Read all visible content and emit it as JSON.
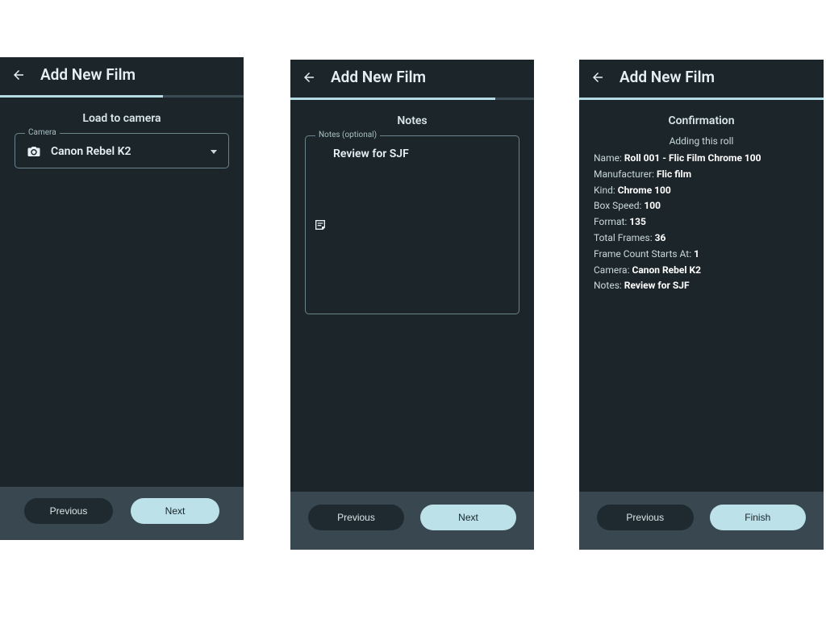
{
  "header": {
    "title": "Add New Film"
  },
  "progress": {
    "screen1_pct": 67,
    "screen2_pct": 84,
    "screen3_pct": 100
  },
  "screen1": {
    "section": "Load to camera",
    "camera_field_label": "Camera",
    "camera_value": "Canon Rebel K2"
  },
  "screen2": {
    "section": "Notes",
    "notes_field_label": "Notes (optional)",
    "notes_value": "Review for SJF"
  },
  "screen3": {
    "section": "Confirmation",
    "subtitle": "Adding this roll",
    "rows": {
      "name_label": "Name: ",
      "name_value": "Roll 001 - Flic Film Chrome 100",
      "manufacturer_label": "Manufacturer: ",
      "manufacturer_value": "Flic film",
      "kind_label": "Kind: ",
      "kind_value": "Chrome 100",
      "boxspeed_label": "Box Speed: ",
      "boxspeed_value": "100",
      "format_label": "Format: ",
      "format_value": "135",
      "totalframes_label": "Total Frames: ",
      "totalframes_value": "36",
      "framecount_label": "Frame Count Starts At: ",
      "framecount_value": "1",
      "camera_label": "Camera: ",
      "camera_value": "Canon Rebel K2",
      "notes_label": "Notes: ",
      "notes_value": "Review for SJF"
    }
  },
  "buttons": {
    "previous": "Previous",
    "next": "Next",
    "finish": "Finish"
  }
}
